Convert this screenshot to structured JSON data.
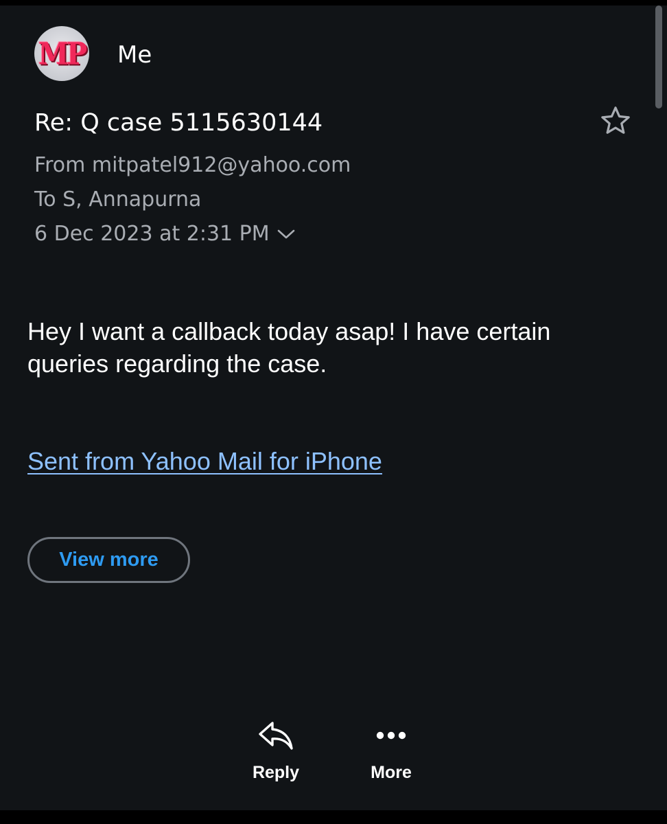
{
  "sender": {
    "avatar_initials": "MP",
    "name": "Me"
  },
  "email": {
    "subject": "Re: Q case 5115630144",
    "from_line": "From mitpatel912@yahoo.com",
    "to_line": "To S, Annapurna",
    "date_line": "6 Dec 2023 at 2:31 PM",
    "body": "Hey I want a callback today asap! I have certain queries regarding the case.",
    "signature_link": "Sent from Yahoo Mail for iPhone",
    "view_more_label": "View more"
  },
  "actions": {
    "reply_label": "Reply",
    "more_label": "More"
  },
  "icons": {
    "star": "star-outline-icon",
    "chevron": "chevron-down-icon",
    "reply": "reply-arrow-icon",
    "more": "ellipsis-icon"
  },
  "colors": {
    "background": "#111417",
    "link": "#8ec1ff",
    "accent_button_text": "#2e9bf2",
    "avatar_letters": "#f0285a"
  }
}
